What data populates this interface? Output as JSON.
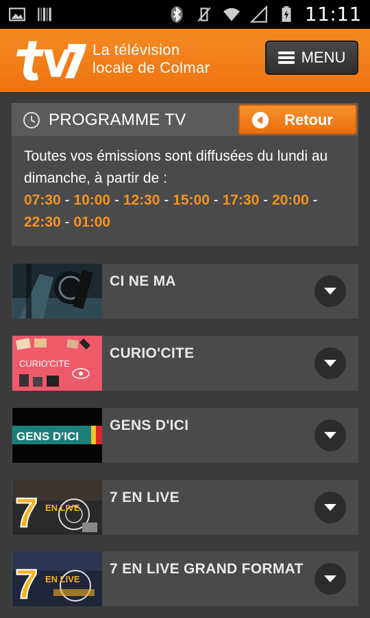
{
  "status_bar": {
    "time": "11:11",
    "icons": [
      "image-icon",
      "barcode-icon",
      "bluetooth-icon",
      "vibrate-off-icon",
      "wifi-icon",
      "signal-icon",
      "battery-icon"
    ]
  },
  "header": {
    "logo_text": "tv7",
    "tagline_line1": "La télévision",
    "tagline_line2": "locale de Colmar",
    "menu_label": "MENU"
  },
  "programme": {
    "title": "PROGRAMME TV",
    "back_label": "Retour",
    "intro": "Toutes vos émissions sont diffusées du lundi au dimanche, à partir de :",
    "times": [
      "07:30",
      "10:00",
      "12:30",
      "15:00",
      "17:30",
      "20:00",
      "22:30",
      "01:00"
    ]
  },
  "shows": [
    {
      "title": "CI NE MA"
    },
    {
      "title": "CURIO'CITE"
    },
    {
      "title": "GENS D'ICI"
    },
    {
      "title": "7 EN LIVE"
    },
    {
      "title": "7 EN LIVE GRAND FORMAT"
    }
  ],
  "thumb_text": {
    "curio": "CURIO'CITE",
    "gens": "GENS D'ICI",
    "seven": "7",
    "live": "EN LIVE"
  },
  "colors": {
    "accent": "#f58a22",
    "background": "#3b3b3b",
    "panel": "#4a4a4a"
  }
}
